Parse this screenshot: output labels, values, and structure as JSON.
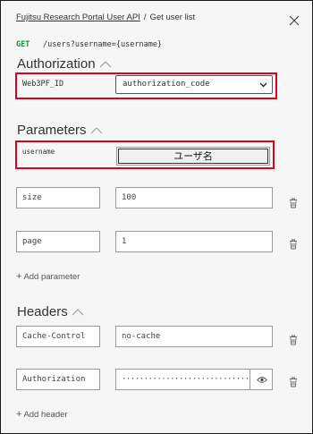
{
  "breadcrumb": {
    "api": "Fujitsu Research Portal User API",
    "separator": "/",
    "endpoint": "Get user list"
  },
  "request": {
    "method": "GET",
    "path": "/users?username={username}"
  },
  "authorization": {
    "title": "Authorization",
    "field_label": "Web3PF_ID",
    "selected": "authorization_code"
  },
  "parameters": {
    "title": "Parameters",
    "username": {
      "label": "username",
      "value": "ユーザ名"
    },
    "rows": [
      {
        "name": "size",
        "value": "100"
      },
      {
        "name": "page",
        "value": "1"
      }
    ],
    "add_label": "Add parameter"
  },
  "headers": {
    "title": "Headers",
    "rows": [
      {
        "name": "Cache-Control",
        "value": "no-cache"
      },
      {
        "name": "Authorization",
        "value": "······························"
      }
    ],
    "add_label": "Add header"
  },
  "icons": [
    "close-icon",
    "chevron-up-icon",
    "chevron-down-icon",
    "trash-icon",
    "eye-icon",
    "plus-icon"
  ],
  "colors": {
    "method": "#1a8f3a",
    "highlight": "#e0001b"
  }
}
